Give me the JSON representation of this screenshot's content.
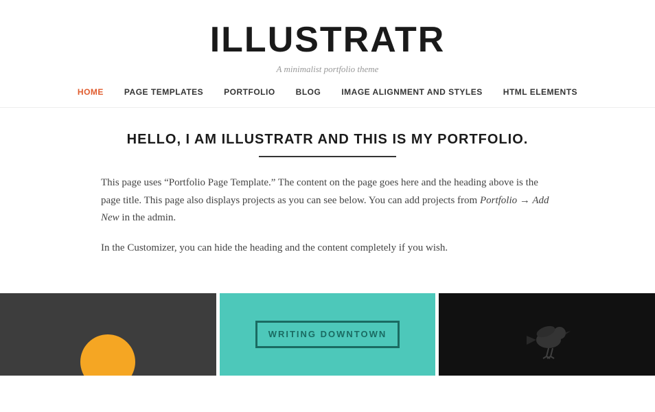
{
  "site": {
    "title": "ILLUSTRATR",
    "tagline": "A minimalist portfolio theme"
  },
  "nav": {
    "items": [
      {
        "label": "HOME",
        "active": true
      },
      {
        "label": "PAGE TEMPLATES",
        "active": false
      },
      {
        "label": "PORTFOLIO",
        "active": false
      },
      {
        "label": "BLOG",
        "active": false
      },
      {
        "label": "IMAGE ALIGNMENT AND STYLES",
        "active": false
      },
      {
        "label": "HTML ELEMENTS",
        "active": false
      }
    ]
  },
  "main": {
    "heading": "HELLO, I AM ILLUSTRATR AND THIS IS MY PORTFOLIO.",
    "paragraph1": "This page uses “Portfolio Page Template.” The content on the page goes here and the heading above is the page title. This page also displays projects as you can see below. You can add projects from Portfolio → Add New in the admin.",
    "paragraph2": "In the Customizer, you can hide the heading and the content completely if you wish.",
    "portfolio": {
      "item2_text": "WRITING DOWNTOWN"
    }
  },
  "colors": {
    "accent": "#e05c2e",
    "teal": "#4dc8ba",
    "orange": "#f5a623",
    "dark": "#3d3d3d",
    "black": "#111"
  }
}
